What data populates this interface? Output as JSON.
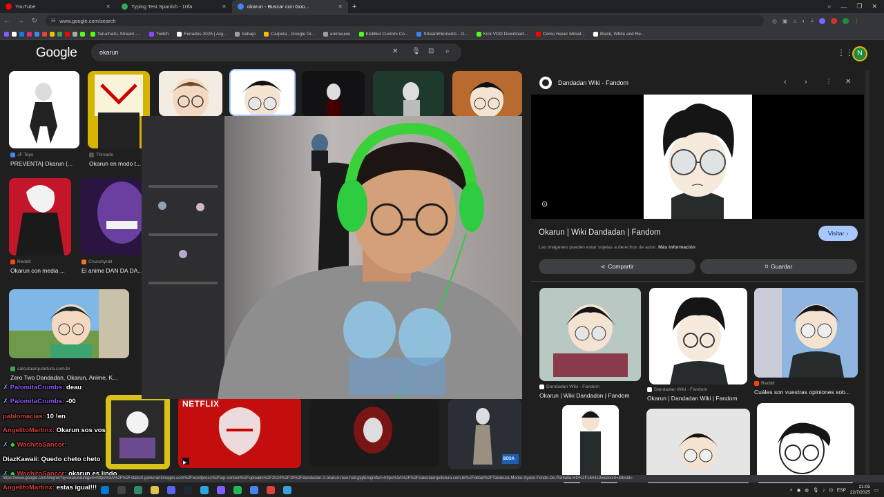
{
  "browser": {
    "tabs": [
      {
        "title": "YouTube",
        "color": "#ff0000",
        "active": false
      },
      {
        "title": "Typing Test Spanish - 10fa",
        "color": "#34a853",
        "active": false
      },
      {
        "title": "okarun - Buscar con Goo...",
        "color": "#4285f4",
        "active": true
      }
    ],
    "url": "www.google.com/search",
    "bookmarks": [
      "TaruchaSL Stream -...",
      "Twitch",
      "Feriados 2025 | Arg...",
      "trabajo",
      "Carpeta - Google Dr...",
      "animuuwu",
      "KickBot Custom Co...",
      "StreamElements - O...",
      "Kick VOD Download...",
      "Como Hacer Miniat...",
      "Black, White and Re..."
    ]
  },
  "google": {
    "logo": "Google",
    "query": "okarun",
    "avatar_letter": "N"
  },
  "results": [
    {
      "source": "JF Toys",
      "title": "PREVENTA] Okarun (..."
    },
    {
      "source": "Threads",
      "title": "Okarun en modo t..."
    },
    {
      "source": "Reddit",
      "title": "Okarun con media ..."
    },
    {
      "source": "Crunchyroll",
      "title": "El anime DAN DA DA..."
    },
    {
      "source": "calcutaarquitetura.com.br",
      "title": "Zero Two Dandadan, Okarun, Anime, K..."
    }
  ],
  "panel": {
    "site": "Dandadan Wiki - Fandom",
    "title": "Okarun | Wiki Dandadan | Fandom",
    "visit": "Visitar",
    "copyright": "Las imágenes pueden estar sujetas a derechos de autor.",
    "more_info": "Más información",
    "share": "Compartir",
    "save": "Guardar",
    "related": [
      {
        "source": "Dandadan Wiki - Fandom",
        "title": "Okarun | Wiki Dandadan | Fandom"
      },
      {
        "source": "Dandadan Wiki - Fandom",
        "title": "Okarun | Dandadan Wiki | Fandom"
      },
      {
        "source": "Reddit",
        "title": "Cuáles son vuestras opiniones sob..."
      }
    ]
  },
  "chat": [
    {
      "user": "PalomitaCrumbs:",
      "msg": "deau",
      "color": "#8a5cf6"
    },
    {
      "user": "PalomitaCrumbs:",
      "msg": "-00",
      "color": "#8a5cf6"
    },
    {
      "user": "pablomacias:",
      "msg": "10 !en",
      "color": "#d04040"
    },
    {
      "user": "AngelitoMartinx:",
      "msg": "Okarun sos vos",
      "color": "#d04040"
    },
    {
      "user": "WachitoSancor:",
      "msg": "",
      "color": "#d04040"
    },
    {
      "user": "DiazKawaii:",
      "msg": "Quedo cheto cheto",
      "color": "#ffffff"
    },
    {
      "user": "WachitoSancor:",
      "msg": "okarun es lindo",
      "color": "#d04040"
    },
    {
      "user": "AngelitoMartinx:",
      "msg": "estas igual!!!",
      "color": "#d04040"
    }
  ],
  "status_url": "https://www.google.com/imgres?q=okarun&imgurl=https%3A%2F%2Fstatic0.gamerantimages.com%2Fwordpress%2Fwp-content%2Fuploads%2F2024%2F10%2Fdandadan-2-okarun-new-hair.jpg&imgrefurl=https%3A%2F%2Fcalcutaarquitetura.com.br%2Fdetail%2FTakakura-Momo-Ayase-Fondo-De-Pantalla-HD%2F1644135&docid=&tbnid=",
  "taskbar": {
    "lang": "ESP",
    "time": "21:05",
    "date": "22/7/2025"
  },
  "stream_overlay": {
    "netflix": "NETFLIX",
    "sega": "SEGA"
  },
  "colors": {
    "accent_blue": "#a8c7fa",
    "button_bg": "#3c4043"
  }
}
